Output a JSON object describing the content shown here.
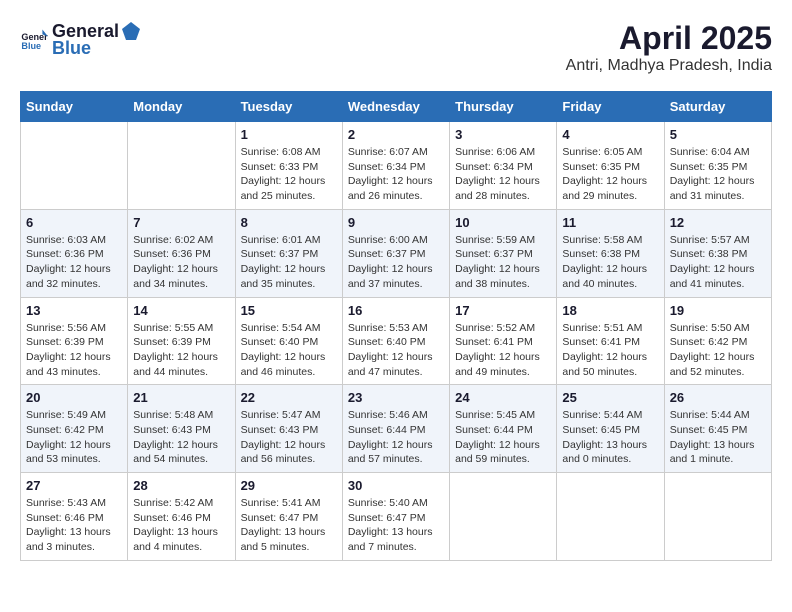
{
  "header": {
    "logo_general": "General",
    "logo_blue": "Blue",
    "month": "April 2025",
    "location": "Antri, Madhya Pradesh, India"
  },
  "weekdays": [
    "Sunday",
    "Monday",
    "Tuesday",
    "Wednesday",
    "Thursday",
    "Friday",
    "Saturday"
  ],
  "weeks": [
    [
      {
        "day": "",
        "detail": ""
      },
      {
        "day": "",
        "detail": ""
      },
      {
        "day": "1",
        "detail": "Sunrise: 6:08 AM\nSunset: 6:33 PM\nDaylight: 12 hours and 25 minutes."
      },
      {
        "day": "2",
        "detail": "Sunrise: 6:07 AM\nSunset: 6:34 PM\nDaylight: 12 hours and 26 minutes."
      },
      {
        "day": "3",
        "detail": "Sunrise: 6:06 AM\nSunset: 6:34 PM\nDaylight: 12 hours and 28 minutes."
      },
      {
        "day": "4",
        "detail": "Sunrise: 6:05 AM\nSunset: 6:35 PM\nDaylight: 12 hours and 29 minutes."
      },
      {
        "day": "5",
        "detail": "Sunrise: 6:04 AM\nSunset: 6:35 PM\nDaylight: 12 hours and 31 minutes."
      }
    ],
    [
      {
        "day": "6",
        "detail": "Sunrise: 6:03 AM\nSunset: 6:36 PM\nDaylight: 12 hours and 32 minutes."
      },
      {
        "day": "7",
        "detail": "Sunrise: 6:02 AM\nSunset: 6:36 PM\nDaylight: 12 hours and 34 minutes."
      },
      {
        "day": "8",
        "detail": "Sunrise: 6:01 AM\nSunset: 6:37 PM\nDaylight: 12 hours and 35 minutes."
      },
      {
        "day": "9",
        "detail": "Sunrise: 6:00 AM\nSunset: 6:37 PM\nDaylight: 12 hours and 37 minutes."
      },
      {
        "day": "10",
        "detail": "Sunrise: 5:59 AM\nSunset: 6:37 PM\nDaylight: 12 hours and 38 minutes."
      },
      {
        "day": "11",
        "detail": "Sunrise: 5:58 AM\nSunset: 6:38 PM\nDaylight: 12 hours and 40 minutes."
      },
      {
        "day": "12",
        "detail": "Sunrise: 5:57 AM\nSunset: 6:38 PM\nDaylight: 12 hours and 41 minutes."
      }
    ],
    [
      {
        "day": "13",
        "detail": "Sunrise: 5:56 AM\nSunset: 6:39 PM\nDaylight: 12 hours and 43 minutes."
      },
      {
        "day": "14",
        "detail": "Sunrise: 5:55 AM\nSunset: 6:39 PM\nDaylight: 12 hours and 44 minutes."
      },
      {
        "day": "15",
        "detail": "Sunrise: 5:54 AM\nSunset: 6:40 PM\nDaylight: 12 hours and 46 minutes."
      },
      {
        "day": "16",
        "detail": "Sunrise: 5:53 AM\nSunset: 6:40 PM\nDaylight: 12 hours and 47 minutes."
      },
      {
        "day": "17",
        "detail": "Sunrise: 5:52 AM\nSunset: 6:41 PM\nDaylight: 12 hours and 49 minutes."
      },
      {
        "day": "18",
        "detail": "Sunrise: 5:51 AM\nSunset: 6:41 PM\nDaylight: 12 hours and 50 minutes."
      },
      {
        "day": "19",
        "detail": "Sunrise: 5:50 AM\nSunset: 6:42 PM\nDaylight: 12 hours and 52 minutes."
      }
    ],
    [
      {
        "day": "20",
        "detail": "Sunrise: 5:49 AM\nSunset: 6:42 PM\nDaylight: 12 hours and 53 minutes."
      },
      {
        "day": "21",
        "detail": "Sunrise: 5:48 AM\nSunset: 6:43 PM\nDaylight: 12 hours and 54 minutes."
      },
      {
        "day": "22",
        "detail": "Sunrise: 5:47 AM\nSunset: 6:43 PM\nDaylight: 12 hours and 56 minutes."
      },
      {
        "day": "23",
        "detail": "Sunrise: 5:46 AM\nSunset: 6:44 PM\nDaylight: 12 hours and 57 minutes."
      },
      {
        "day": "24",
        "detail": "Sunrise: 5:45 AM\nSunset: 6:44 PM\nDaylight: 12 hours and 59 minutes."
      },
      {
        "day": "25",
        "detail": "Sunrise: 5:44 AM\nSunset: 6:45 PM\nDaylight: 13 hours and 0 minutes."
      },
      {
        "day": "26",
        "detail": "Sunrise: 5:44 AM\nSunset: 6:45 PM\nDaylight: 13 hours and 1 minute."
      }
    ],
    [
      {
        "day": "27",
        "detail": "Sunrise: 5:43 AM\nSunset: 6:46 PM\nDaylight: 13 hours and 3 minutes."
      },
      {
        "day": "28",
        "detail": "Sunrise: 5:42 AM\nSunset: 6:46 PM\nDaylight: 13 hours and 4 minutes."
      },
      {
        "day": "29",
        "detail": "Sunrise: 5:41 AM\nSunset: 6:47 PM\nDaylight: 13 hours and 5 minutes."
      },
      {
        "day": "30",
        "detail": "Sunrise: 5:40 AM\nSunset: 6:47 PM\nDaylight: 13 hours and 7 minutes."
      },
      {
        "day": "",
        "detail": ""
      },
      {
        "day": "",
        "detail": ""
      },
      {
        "day": "",
        "detail": ""
      }
    ]
  ]
}
